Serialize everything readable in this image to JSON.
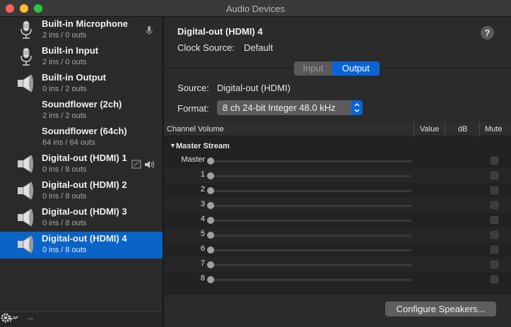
{
  "window": {
    "title": "Audio Devices"
  },
  "devices": [
    {
      "name": "Built-in Microphone",
      "io": "2 ins / 0 outs",
      "icon": "microphone-icon",
      "indicator": "mic-default-icon"
    },
    {
      "name": "Built-in Input",
      "io": "2 ins / 0 outs",
      "icon": "microphone-icon"
    },
    {
      "name": "Built-in Output",
      "io": "0 ins / 2 outs",
      "icon": "speaker-icon"
    },
    {
      "name": "Soundflower (2ch)",
      "io": "2 ins / 2 outs",
      "icon": ""
    },
    {
      "name": "Soundflower (64ch)",
      "io": "64 ins / 64 outs",
      "icon": ""
    },
    {
      "name": "Digital-out (HDMI) 1",
      "io": "0 ins / 8 outs",
      "icon": "speaker-icon",
      "indicator": "system-output-and-speaker-icon"
    },
    {
      "name": "Digital-out (HDMI) 2",
      "io": "0 ins / 8 outs",
      "icon": "speaker-icon"
    },
    {
      "name": "Digital-out (HDMI) 3",
      "io": "0 ins / 8 outs",
      "icon": "speaker-icon"
    },
    {
      "name": "Digital-out (HDMI) 4",
      "io": "0 ins / 8 outs",
      "icon": "speaker-icon",
      "selected": true
    }
  ],
  "sidebar_footer": {
    "add": "+",
    "remove": "−"
  },
  "detail": {
    "title": "Digital-out (HDMI) 4",
    "clock_label": "Clock Source:",
    "clock_value": "Default",
    "help": "?",
    "tabs": {
      "input": "Input",
      "output": "Output",
      "active": "output"
    },
    "source_label": "Source:",
    "source_value": "Digital-out (HDMI)",
    "format_label": "Format:",
    "format_value": "8 ch 24-bit Integer 48.0 kHz"
  },
  "table": {
    "headers": {
      "channel_volume": "Channel Volume",
      "value": "Value",
      "db": "dB",
      "mute": "Mute"
    },
    "group": "Master Stream",
    "rows": [
      {
        "label": "Master"
      },
      {
        "label": "1"
      },
      {
        "label": "2"
      },
      {
        "label": "3"
      },
      {
        "label": "4"
      },
      {
        "label": "5"
      },
      {
        "label": "6"
      },
      {
        "label": "7"
      },
      {
        "label": "8"
      }
    ]
  },
  "configure_button": "Configure Speakers...",
  "colors": {
    "accent": "#0a64c8",
    "close": "#ff5f57",
    "minimize": "#febc2e",
    "zoom": "#28c840"
  }
}
